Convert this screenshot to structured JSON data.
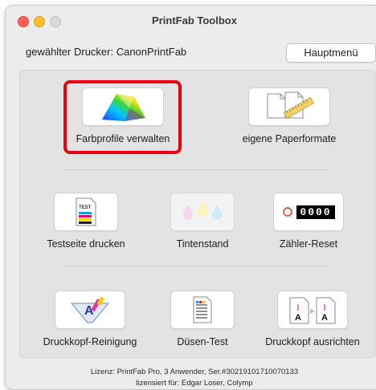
{
  "window": {
    "title": "PrintFab Toolbox"
  },
  "printer": {
    "label": "gewählter Drucker: CanonPrintFab"
  },
  "toolbar": {
    "main_menu_label": "Hauptmenü"
  },
  "tools": {
    "color_profiles": {
      "label": "Farbprofile verwalten",
      "selected": true
    },
    "paper_formats": {
      "label": "eigene Paperformate"
    },
    "test_page": {
      "label": "Testseite drucken",
      "icon_text": "TEST"
    },
    "ink_level": {
      "label": "Tintenstand"
    },
    "counter_reset": {
      "label": "Zähler-Reset",
      "counter_value": "0000"
    },
    "head_cleaning": {
      "label": "Druckkopf-Reinigung"
    },
    "nozzle_test": {
      "label": "Düsen-Test"
    },
    "head_align": {
      "label": "Druckkopf ausrichten"
    }
  },
  "license": {
    "line1": "Lizenz: PrintFab Pro, 3 Anwender, Ser.#30219101710070133",
    "line2": "lizensiert für: Edgar Loser, Colymp"
  },
  "colors": {
    "highlight": "#e8000d",
    "close": "#fe5f57",
    "minimize": "#febc2e"
  }
}
